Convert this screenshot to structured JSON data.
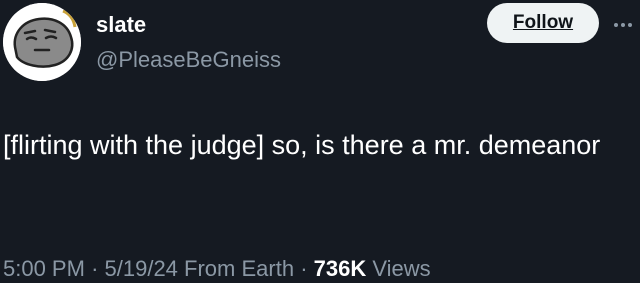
{
  "author": {
    "display_name": "slate",
    "handle": "@PleaseBeGneiss",
    "avatar_icon": "rock-face-avatar"
  },
  "follow_button": {
    "label": "Follow"
  },
  "more_icon": "more-options-icon",
  "tweet": {
    "text": "[flirting with the judge] so, is there a mr. demeanor"
  },
  "meta": {
    "time": "5:00 PM",
    "separator": "·",
    "date": "5/19/24",
    "source": "From Earth",
    "views_count": "736K",
    "views_label": "Views"
  },
  "colors": {
    "background": "#151a22",
    "secondary_text": "#8b98a5",
    "follow_bg": "#eff3f4"
  }
}
